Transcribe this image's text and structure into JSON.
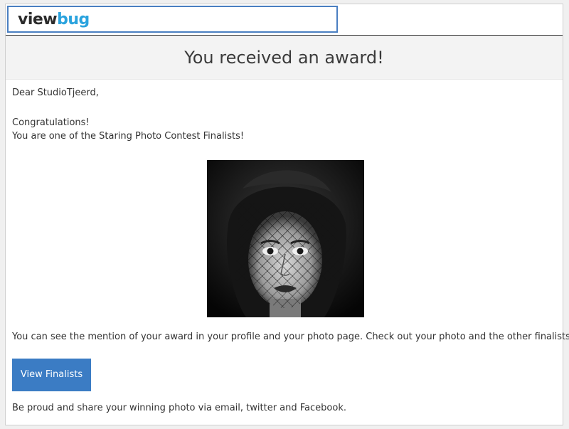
{
  "header": {
    "logo_part1": "view",
    "logo_part2": "bug"
  },
  "banner": {
    "title": "You received an award!"
  },
  "email": {
    "greeting": "Dear StudioTjeerd,",
    "line1": "Congratulations!",
    "line2": "You are one of the Staring Photo Contest Finalists!",
    "mention_text": "You can see the mention of your award in your profile and your photo page. Check out your photo and the other finalists:",
    "button_label": "View Finalists",
    "closing": "Be proud and share your winning photo via email, twitter and Facebook."
  },
  "colors": {
    "logo_dark": "#2b2b2b",
    "logo_accent": "#2aa3de",
    "button_bg": "#3b7cc4",
    "banner_bg": "#f3f3f3"
  }
}
